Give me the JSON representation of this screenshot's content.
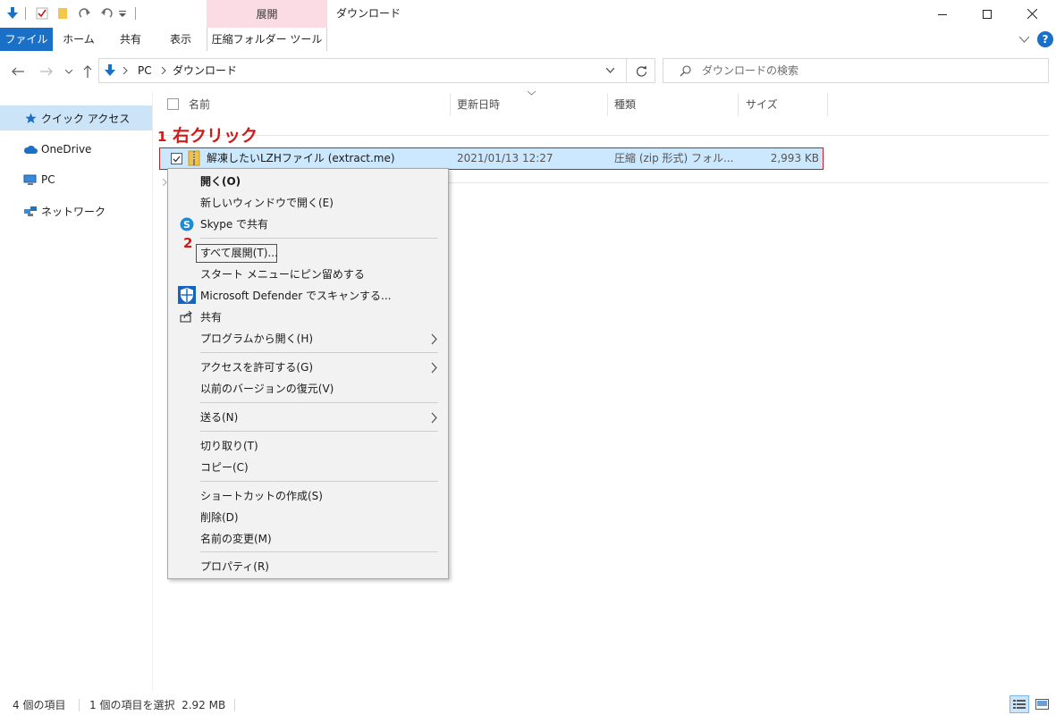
{
  "window": {
    "title": "ダウンロード",
    "context_tab_group": "展開",
    "colors": {
      "file_tab": "#1a6fc7",
      "context_group": "#fbdbe4",
      "selection": "#cce8ff",
      "annotation": "#d01a1a"
    }
  },
  "ribbon": {
    "tabs": [
      "ファイル",
      "ホーム",
      "共有",
      "表示",
      "圧縮フォルダー ツール"
    ]
  },
  "address": {
    "path": [
      "PC",
      "ダウンロード"
    ],
    "search_placeholder": "ダウンロードの検索"
  },
  "sidebar": {
    "items": [
      "クイック アクセス",
      "OneDrive",
      "PC",
      "ネットワーク"
    ]
  },
  "columns": [
    "名前",
    "更新日時",
    "種類",
    "サイズ"
  ],
  "file": {
    "name": "解凍したいLZHファイル (extract.me)",
    "modified": "2021/01/13 12:27",
    "type": "圧縮 (zip 形式) フォル...",
    "size": "2,993 KB"
  },
  "annotations": {
    "step1_num": "1",
    "step1_text": "右クリック",
    "step2_num": "2"
  },
  "context_menu": {
    "open": "開く(O)",
    "open_new_window": "新しいウィンドウで開く(E)",
    "skype_share": "Skype で共有",
    "extract_all": "すべて展開(T)...",
    "pin_start": "スタート メニューにピン留めする",
    "defender_scan": "Microsoft Defender でスキャンする...",
    "share": "共有",
    "open_with": "プログラムから開く(H)",
    "give_access": "アクセスを許可する(G)",
    "restore_versions": "以前のバージョンの復元(V)",
    "send_to": "送る(N)",
    "cut": "切り取り(T)",
    "copy": "コピー(C)",
    "create_shortcut": "ショートカットの作成(S)",
    "delete": "削除(D)",
    "rename": "名前の変更(M)",
    "properties": "プロパティ(R)"
  },
  "status": {
    "item_count": "4 個の項目",
    "selection": "1 個の項目を選択  2.92 MB"
  }
}
